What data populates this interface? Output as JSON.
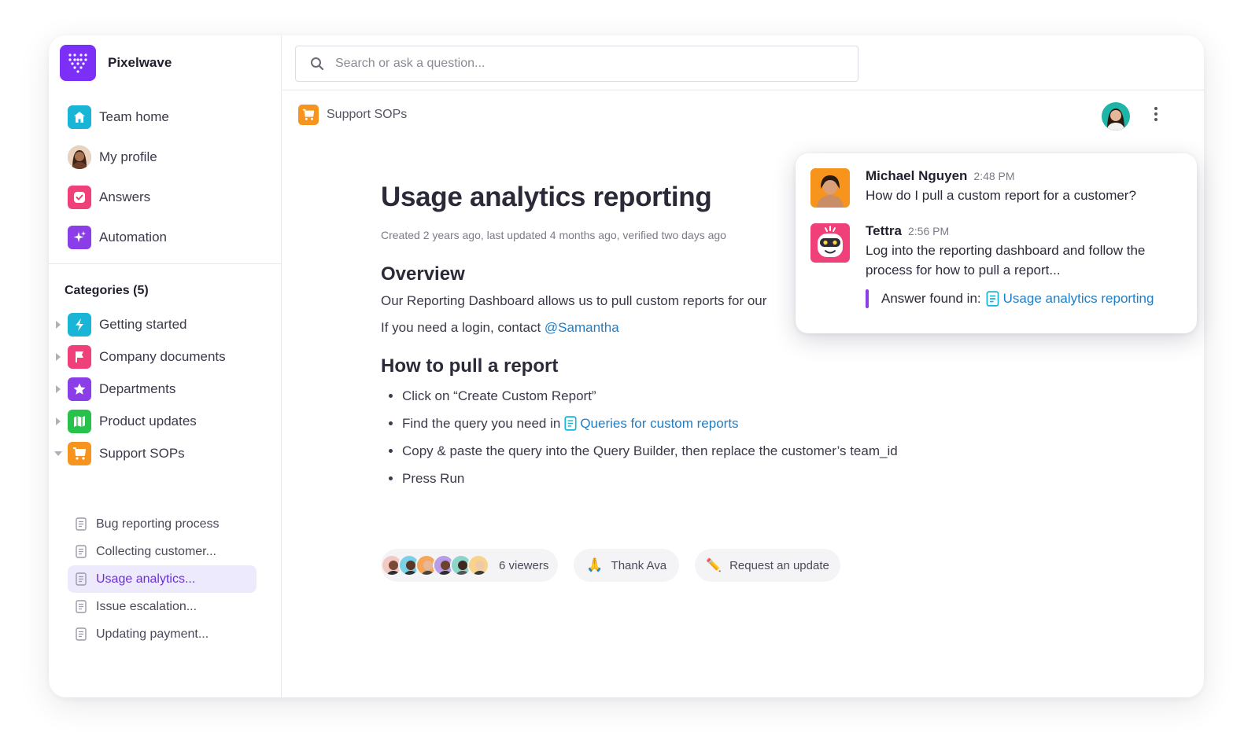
{
  "brand": {
    "name": "Pixelwave",
    "color": "#7b2ff7"
  },
  "nav": [
    {
      "label": "Team home",
      "icon": "home-icon",
      "color": "#19b5d6"
    },
    {
      "label": "My profile",
      "icon": "avatar"
    },
    {
      "label": "Answers",
      "icon": "answers-icon",
      "color": "#f0407a"
    },
    {
      "label": "Automation",
      "icon": "sparkle-icon",
      "color": "#8b3ee8"
    }
  ],
  "categories": {
    "title": "Categories (5)",
    "items": [
      {
        "label": "Getting started",
        "icon": "bolt-icon",
        "color": "#19b5d6"
      },
      {
        "label": "Company documents",
        "icon": "flag-icon",
        "color": "#f0407a"
      },
      {
        "label": "Departments",
        "icon": "star-icon",
        "color": "#8b3ee8"
      },
      {
        "label": "Product updates",
        "icon": "map-icon",
        "color": "#27c24c"
      },
      {
        "label": "Support SOPs",
        "icon": "cart-icon",
        "color": "#f7941d"
      }
    ],
    "docs": [
      {
        "label": "Bug reporting process",
        "active": false
      },
      {
        "label": "Collecting customer...",
        "active": false
      },
      {
        "label": "Usage analytics...",
        "active": true
      },
      {
        "label": "Issue escalation...",
        "active": false
      },
      {
        "label": "Updating payment...",
        "active": false
      }
    ]
  },
  "search": {
    "placeholder": "Search or ask a question..."
  },
  "breadcrumb": {
    "label": "Support SOPs"
  },
  "article": {
    "title": "Usage analytics reporting",
    "meta": "Created 2 years ago, last updated 4 months ago, verified two days ago",
    "overview_heading": "Overview",
    "overview_text": "Our Reporting Dashboard allows us to pull custom reports for our",
    "login_text": "If you need a login, contact ",
    "login_mention": "@Samantha",
    "howto_heading": "How to pull a report",
    "steps": {
      "s1": "Click on “Create Custom Report”",
      "s2_prefix": "Find the query you need in ",
      "s2_link": "Queries for custom reports",
      "s3": "Copy & paste the query into the Query Builder, then replace the customer’s team_id",
      "s4": "Press Run"
    }
  },
  "footer": {
    "viewers": "6 viewers",
    "thank": "Thank Ava",
    "thank_emoji": "🙏",
    "request": "Request an update",
    "request_emoji": "✏️"
  },
  "chat": {
    "messages": [
      {
        "name": "Michael Nguyen",
        "time": "2:48 PM",
        "text": "How do I pull a custom report for a customer?"
      },
      {
        "name": "Tettra",
        "time": "2:56 PM",
        "text": "Log into the reporting dashboard and follow the process for how to pull a report..."
      }
    ],
    "answer_label": "Answer found in:",
    "answer_link": "Usage analytics reporting"
  }
}
